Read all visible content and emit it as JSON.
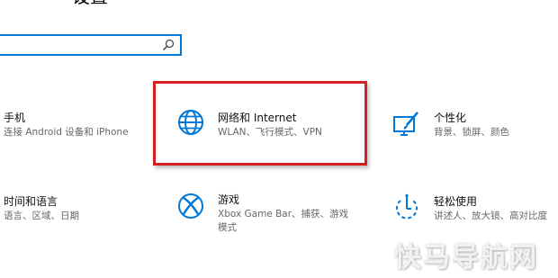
{
  "page_title": "设置",
  "search": {
    "placeholder": "",
    "value": ""
  },
  "tiles": {
    "phone": {
      "title": "手机",
      "desc": "连接 Android 设备和 iPhone",
      "icon": "phone-icon"
    },
    "network": {
      "title": "网络和 Internet",
      "desc": "WLAN、飞行模式、VPN",
      "icon": "globe-icon"
    },
    "personalization": {
      "title": "个性化",
      "desc": "背景、锁屏、颜色",
      "icon": "paint-brush-icon"
    },
    "time_language": {
      "title": "时间和语言",
      "desc": "语言、区域、日期",
      "icon": "clock-language-icon"
    },
    "gaming": {
      "title": "游戏",
      "desc": "Xbox Game Bar、捕获、游戏模式",
      "icon": "xbox-icon"
    },
    "ease_of_access": {
      "title": "轻松使用",
      "desc": "讲述人、放大镜、高对比度",
      "icon": "ease-of-access-icon"
    }
  },
  "colors": {
    "accent": "#0078d7",
    "highlight": "#d42020"
  },
  "watermark": "快马导航网"
}
